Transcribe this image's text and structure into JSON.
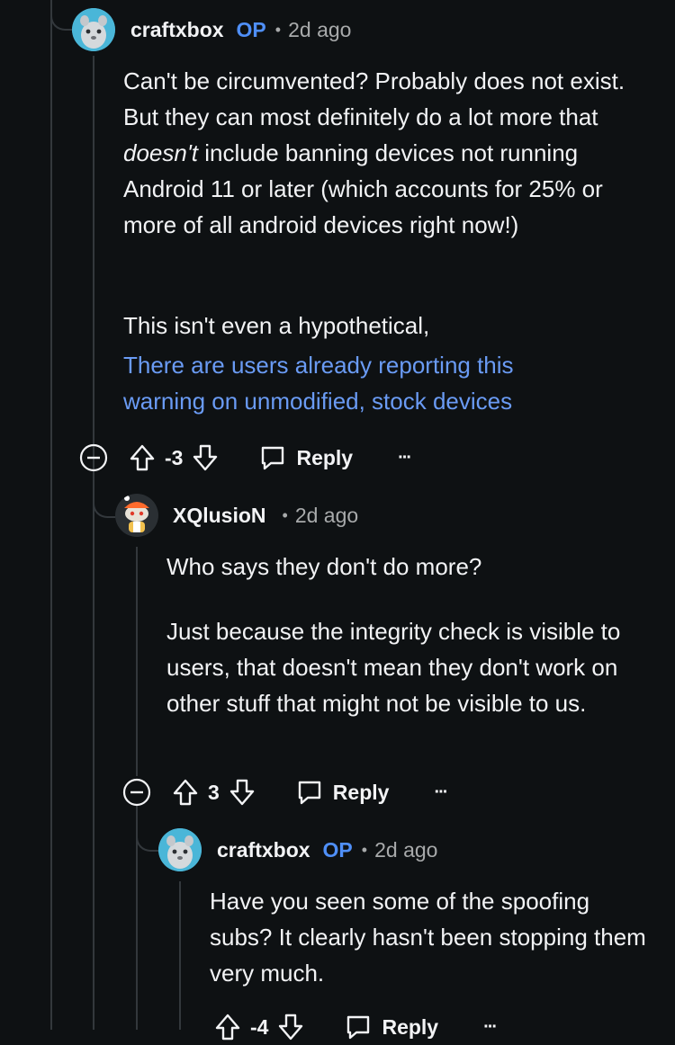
{
  "comments": [
    {
      "username": "craftxbox",
      "op_badge": "OP",
      "time": "2d ago",
      "paragraph1": "Can't be circumvented? Probably does not exist. But they can most definitely do a lot more that",
      "emphasis": "doesn't",
      "paragraph1_rest": "include banning devices not running Android 11 or later (which accounts for 25% or more of all android devices right now!)",
      "paragraph2": "This isn't even a hypothetical,",
      "link_text": "There are users already reporting this warning on unmodified, stock devices",
      "score": "-3",
      "reply_label": "Reply",
      "more_label": "···"
    },
    {
      "username": "XQlusioN",
      "time": "2d ago",
      "paragraph1": "Who says they don't do more?",
      "paragraph2": "Just because the integrity check is visible to users, that doesn't mean they don't work on other stuff that might not be visible to us.",
      "score": "3",
      "reply_label": "Reply",
      "more_label": "···"
    },
    {
      "username": "craftxbox",
      "op_badge": "OP",
      "time": "2d ago",
      "paragraph1": "Have you seen some of the spoofing subs? It clearly hasn't been stopping them very much.",
      "score": "-4",
      "reply_label": "Reply",
      "more_label": "···"
    }
  ],
  "dot_separator": "•",
  "icons": [
    "collapse-icon",
    "upvote-icon",
    "downvote-icon",
    "reply-icon",
    "more-icon"
  ]
}
